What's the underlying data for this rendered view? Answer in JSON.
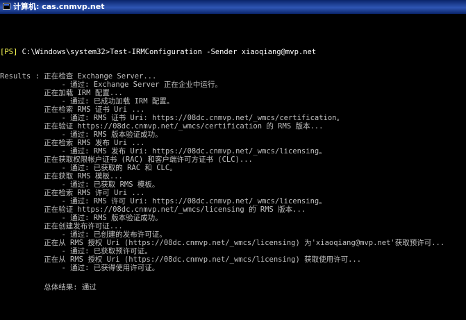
{
  "window": {
    "title": "计算机: cas.cnmvp.net",
    "icon": "console-icon"
  },
  "console": {
    "prompt_tag": "[PS]",
    "prompt_path": " C:\\Windows\\system32>",
    "command": "Test-IRMConfiguration -Sender xiaoqiang@mvp.net",
    "lines": [
      "Results : 正在检查 Exchange Server...",
      "              - 通过: Exchange Server 正在企业中运行。",
      "          正在加载 IRM 配置...",
      "              - 通过: 已成功加载 IRM 配置。",
      "          正在检索 RMS 证书 Uri ...",
      "              - 通过: RMS 证书 Uri: https://08dc.cnmvp.net/_wmcs/certification。",
      "          正在验证 https://08dc.cnmvp.net/_wmcs/certification 的 RMS 版本...",
      "              - 通过: RMS 版本验证成功。",
      "          正在检索 RMS 发布 Uri ...",
      "              - 通过: RMS 发布 Uri: https://08dc.cnmvp.net/_wmcs/licensing。",
      "          正在获取权限帐户证书 (RAC) 和客户端许可方证书 (CLC)...",
      "              - 通过: 已获取的 RAC 和 CLC。",
      "          正在获取 RMS 模板...",
      "              - 通过: 已获取 RMS 模板。",
      "          正在检索 RMS 许可 Uri ...",
      "              - 通过: RMS 许可 Uri: https://08dc.cnmvp.net/_wmcs/licensing。",
      "          正在验证 https://08dc.cnmvp.net/_wmcs/licensing 的 RMS 版本...",
      "              - 通过: RMS 版本验证成功。",
      "          正在创建发布许可证...",
      "              - 通过: 已创建的发布许可证。",
      "          正在从 RMS 授权 Uri (https://08dc.cnmvp.net/_wmcs/licensing) 为'xiaoqiang@mvp.net'获取预许可...",
      "              - 通过: 已获取预许可证。",
      "          正在从 RMS 授权 Uri (https://08dc.cnmvp.net/_wmcs/licensing) 获取使用许可...",
      "              - 通过: 已获得使用许可证。",
      "",
      "          总体结果: 通过"
    ]
  }
}
